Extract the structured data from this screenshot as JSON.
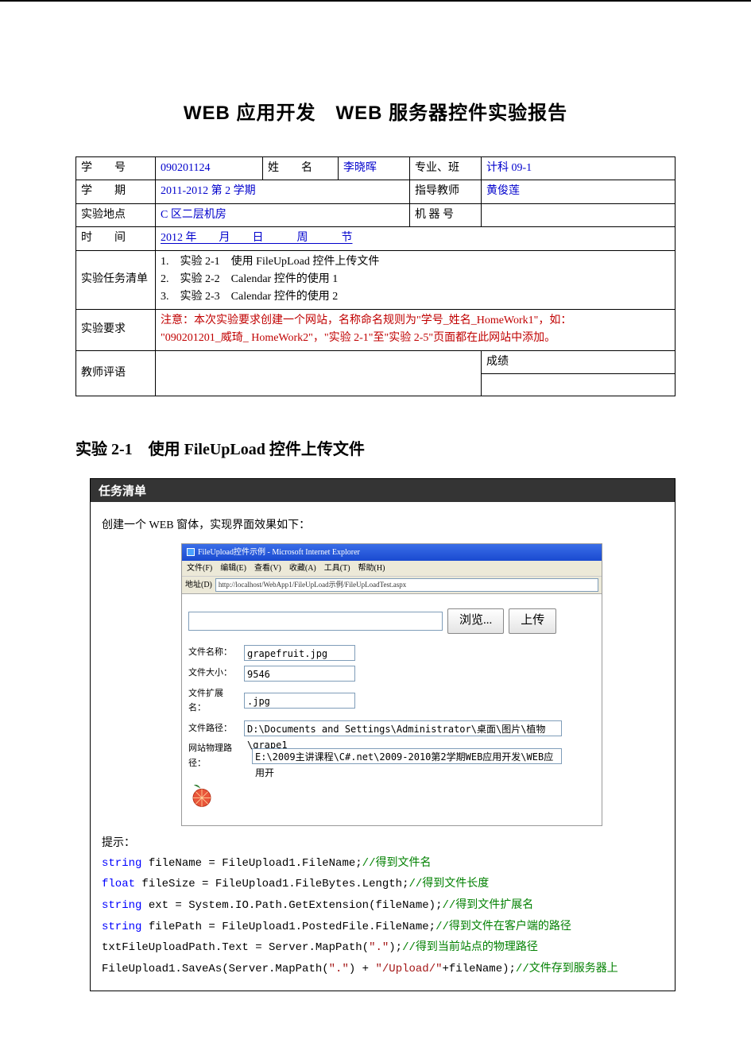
{
  "title": "WEB 应用开发　WEB 服务器控件实验报告",
  "labels": {
    "student_id": "学　　号",
    "name": "姓　　名",
    "major": "专业、班",
    "term": "学　　期",
    "advisor": "指导教师",
    "location": "实验地点",
    "machine": "机 器 号",
    "time": "时　　间",
    "task_list": "实验任务清单",
    "requirement": "实验要求",
    "teacher_comment": "教师评语",
    "grade": "成绩"
  },
  "info": {
    "student_id": "090201124",
    "name": "李晓晖",
    "major": "计科 09-1",
    "term": "2011-2012 第 2 学期",
    "advisor": "黄俊莲",
    "location": "C 区二层机房",
    "machine": "",
    "time": "2012 年　　月　　日　　　周　　　节",
    "tasks": {
      "t1": "1.　实验 2-1　使用 FileUpLoad 控件上传文件",
      "t2": "2.　实验 2-2　Calendar 控件的使用 1",
      "t3": "3.　实验 2-3　Calendar 控件的使用 2"
    },
    "requirement_l1": "注意：本次实验要求创建一个网站，名称命名规则为\"学号_姓名_HomeWork1\"，如：",
    "requirement_l2": "\"090201201_威琦_ HomeWork2\"，\"实验 2-1\"至\"实验 2-5\"页面都在此网站中添加。",
    "teacher_comment": "",
    "grade": ""
  },
  "section1": {
    "heading": "实验 2-1　使用 FileUpLoad 控件上传文件",
    "task_header": "任务清单",
    "intro": "创建一个 WEB 窗体，实现界面效果如下：",
    "hint_label": "提示："
  },
  "browser": {
    "window_title": "FileUpload控件示例 - Microsoft Internet Explorer",
    "menu": "文件(F)　编辑(E)　查看(V)　收藏(A)　工具(T)　帮助(H)",
    "addr_label": "地址(D)",
    "url": "http://localhost/WebApp1/FileUpLoad示例/FileUpLoadTest.aspx",
    "browse_btn": "浏览...",
    "upload_btn": "上传",
    "fields": {
      "filename_label": "文件名称：",
      "filename_value": "grapefruit.jpg",
      "filesize_label": "文件大小：",
      "filesize_value": "9546",
      "ext_label": "文件扩展名：",
      "ext_value": ".jpg",
      "filepath_label": "文件路径：",
      "filepath_value": "D:\\Documents and Settings\\Administrator\\桌面\\图片\\植物\\grape1",
      "sitepath_label": "网站物理路径：",
      "sitepath_value": "E:\\2009主讲课程\\C#.net\\2009-2010第2学期WEB应用开发\\WEB应用开"
    }
  },
  "code": {
    "kw_string": "string",
    "kw_float": "float",
    "l1a": " fileName = FileUpload1.FileName;",
    "l1c": "//得到文件名",
    "l2a": " fileSize = FileUpload1.FileBytes.Length;",
    "l2c": "//得到文件长度",
    "l3a": " ext = System.IO.Path.GetExtension(fileName);",
    "l3c": "//得到文件扩展名",
    "l4a": " filePath = FileUpload1.PostedFile.FileName;",
    "l4c": "//得到文件在客户端的路径",
    "l5a": "txtFileUploadPath.Text = Server.MapPath(",
    "l5s": "\".\"",
    "l5b": ");",
    "l5c": "//得到当前站点的物理路径",
    "l6a": "FileUpload1.SaveAs(Server.MapPath(",
    "l6s1": "\".\"",
    "l6b": ") + ",
    "l6s2": "\"/Upload/\"",
    "l6d": "+fileName);",
    "l6c": "//文件存到服务器上"
  }
}
